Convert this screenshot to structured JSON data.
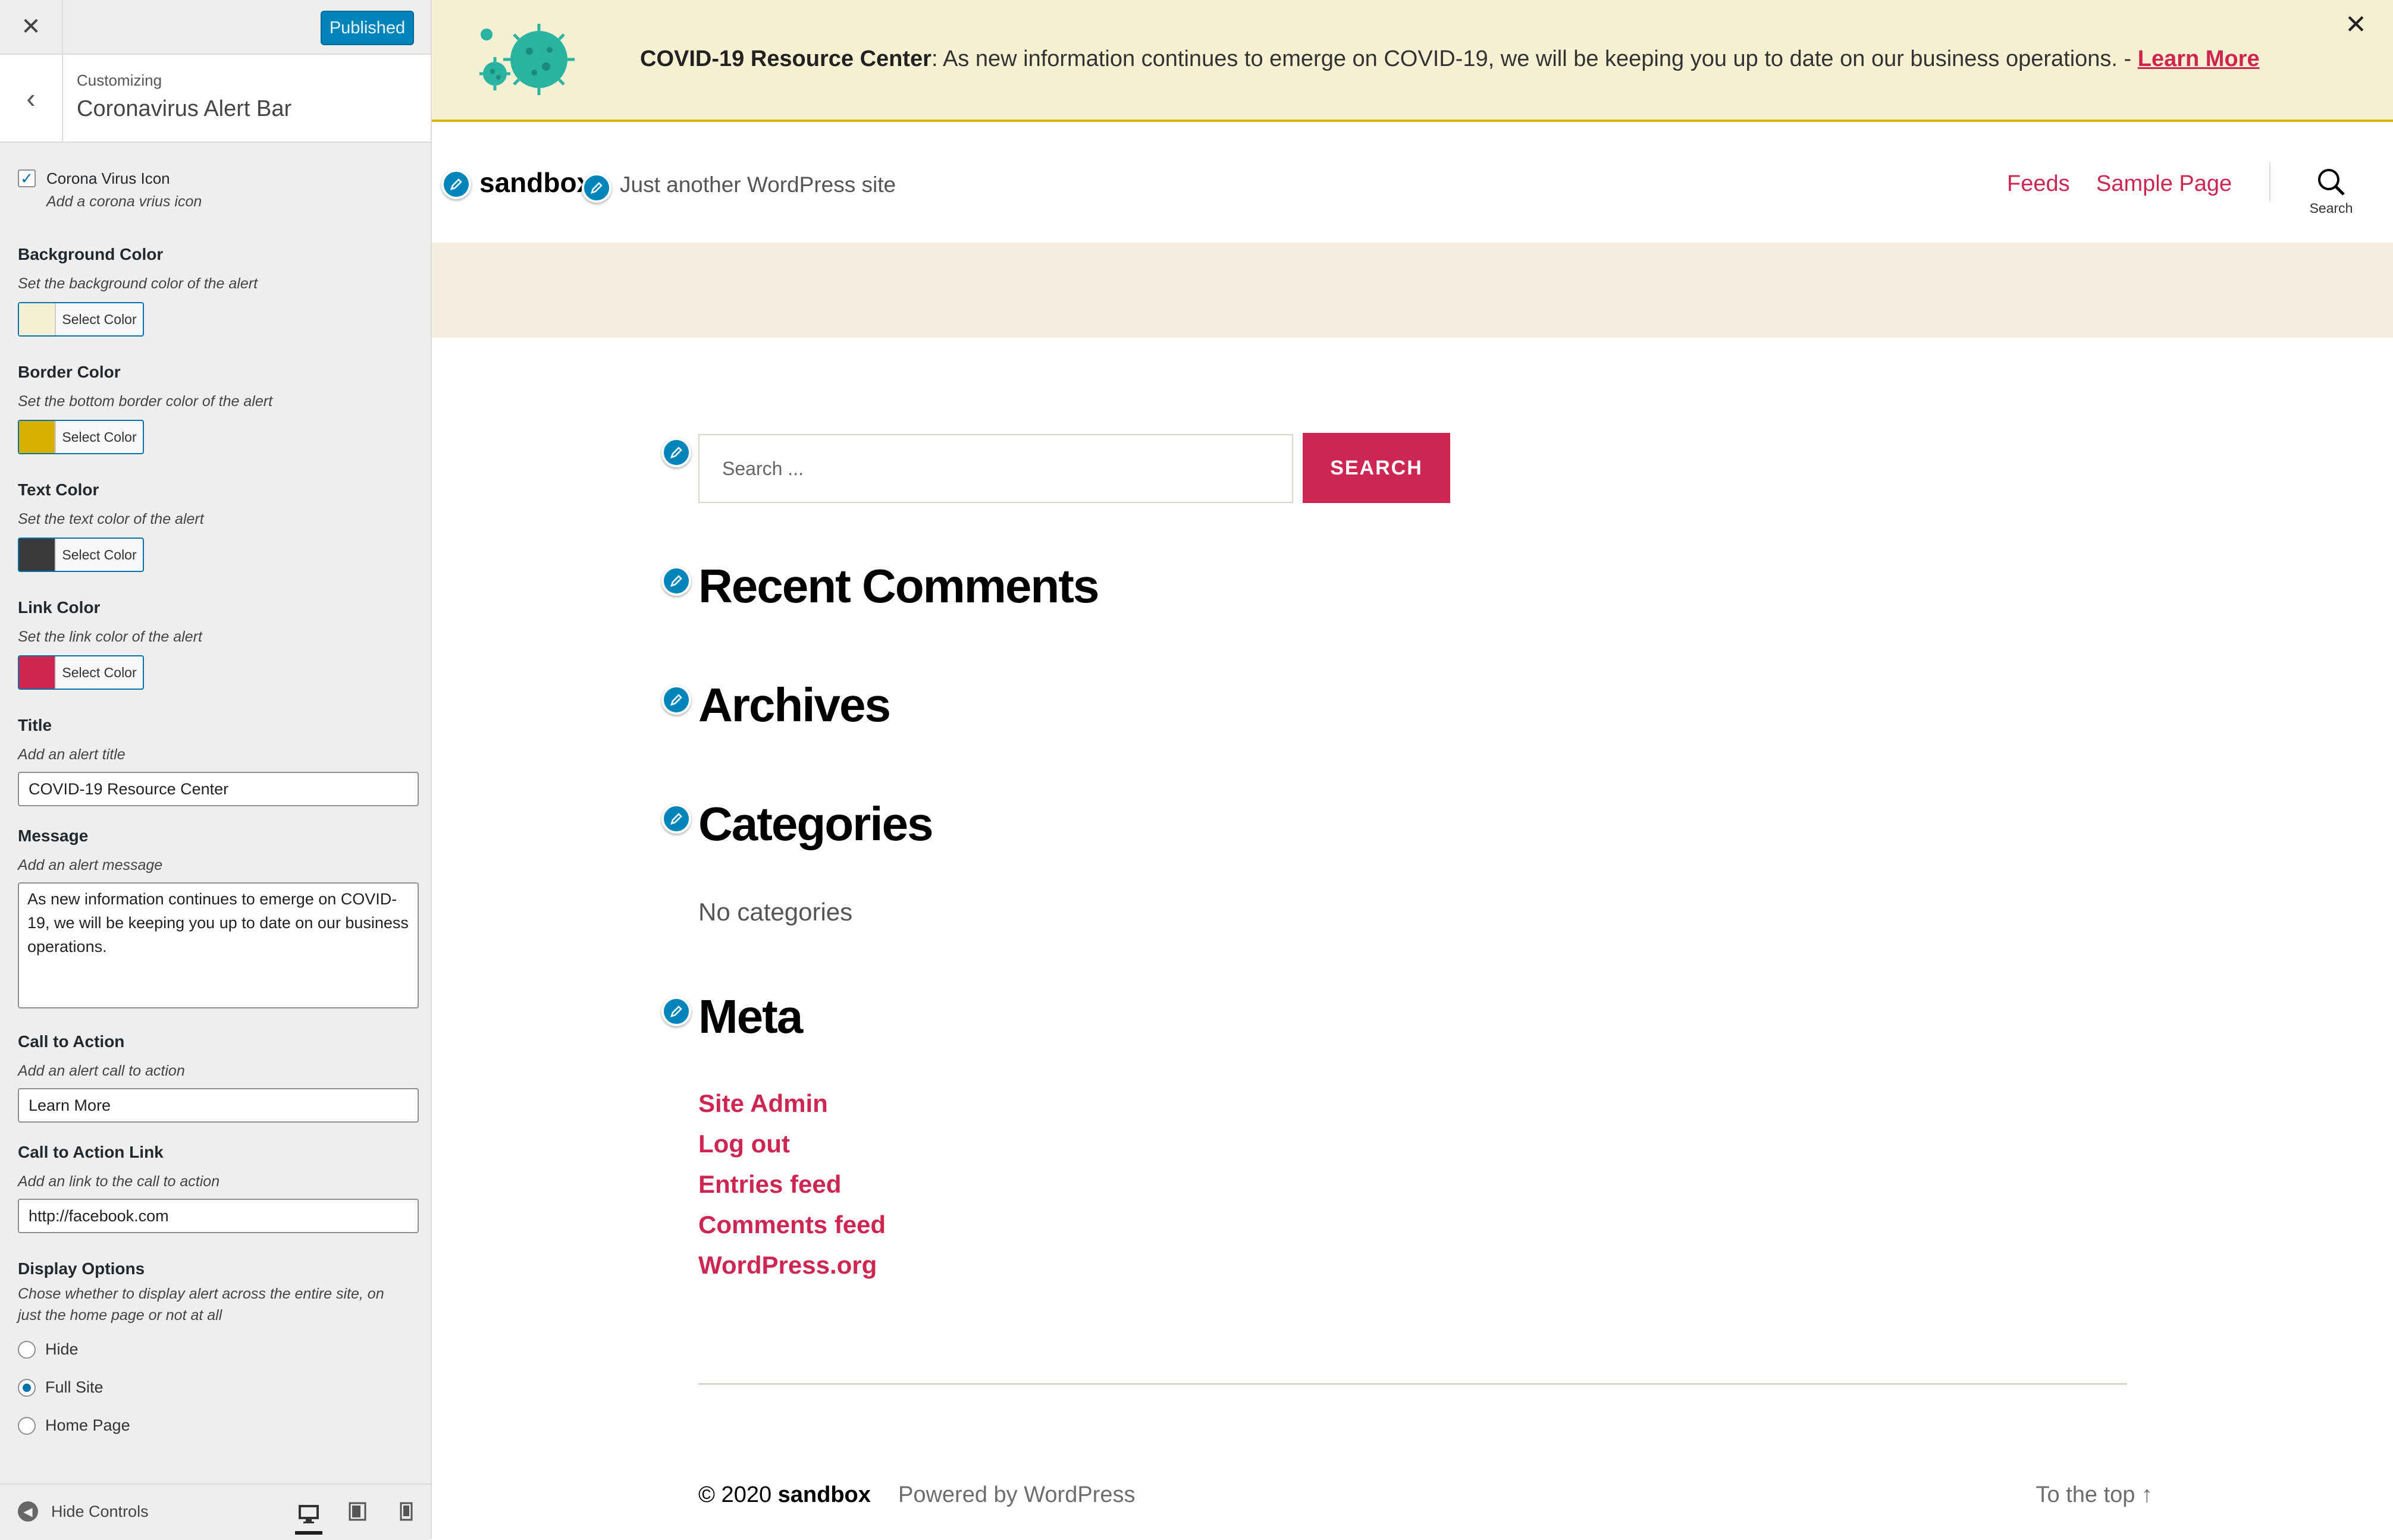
{
  "customizer": {
    "close_icon": "close-icon",
    "publish_label": "Published",
    "breadcrumb_small": "Customizing",
    "section_title": "Coronavirus Alert Bar",
    "checkbox": {
      "label": "Corona Virus Icon",
      "desc": "Add a corona vrius icon",
      "checked": true
    },
    "colors": [
      {
        "label": "Background Color",
        "desc": "Set the background color of the alert",
        "button": "Select Color",
        "swatch": "#f8f0d4"
      },
      {
        "label": "Border Color",
        "desc": "Set the bottom border color of the alert",
        "button": "Select Color",
        "swatch": "#d8b000"
      },
      {
        "label": "Text Color",
        "desc": "Set the text color of the alert",
        "button": "Select Color",
        "swatch": "#3a3a3a"
      },
      {
        "label": "Link Color",
        "desc": "Set the link color of the alert",
        "button": "Select Color",
        "swatch": "#d02450"
      }
    ],
    "title_field": {
      "label": "Title",
      "desc": "Add an alert title",
      "value": "COVID-19 Resource Center"
    },
    "message_field": {
      "label": "Message",
      "desc": "Add an alert message",
      "value": "As new information continues to emerge on COVID-19, we will be keeping you up to date on our business operations."
    },
    "cta_field": {
      "label": "Call to Action",
      "desc": "Add an alert call to action",
      "value": "Learn More"
    },
    "cta_link_field": {
      "label": "Call to Action Link",
      "desc": "Add an link to the call to action",
      "value": "http://facebook.com"
    },
    "display": {
      "label": "Display Options",
      "desc": "Chose whether to display alert across the entire site, on just the home page or not at all",
      "options": [
        "Hide",
        "Full Site",
        "Home Page"
      ],
      "selected": "Full Site"
    },
    "footer": {
      "hide_controls": "Hide Controls",
      "devices": [
        "desktop-icon",
        "tablet-icon",
        "mobile-icon"
      ],
      "active_device": "desktop-icon"
    }
  },
  "preview": {
    "alert": {
      "title": "COVID-19 Resource Center",
      "message": ": As new information continues to emerge on COVID-19, we will be keeping you up to date on our business operations. - ",
      "cta": "Learn More",
      "icon": "virus-icon",
      "close_icon": "close-icon"
    },
    "site": {
      "title": "sandbox",
      "tagline": "Just another WordPress site",
      "nav": [
        "Feeds",
        "Sample Page"
      ],
      "search_label": "Search"
    },
    "search_widget": {
      "placeholder": "Search ...",
      "button": "SEARCH"
    },
    "widgets": {
      "recent_comments": "Recent Comments",
      "archives": "Archives",
      "categories": "Categories",
      "categories_empty": "No categories",
      "meta": "Meta",
      "meta_links": [
        "Site Admin",
        "Log out",
        "Entries feed",
        "Comments feed",
        "WordPress.org"
      ]
    },
    "footer": {
      "copyright": "© 2020",
      "site": "sandbox",
      "powered": "Powered by WordPress",
      "to_top": "To the top ↑"
    }
  },
  "colors": {
    "accent": "#cd2653",
    "wp_blue": "#0085ba"
  }
}
